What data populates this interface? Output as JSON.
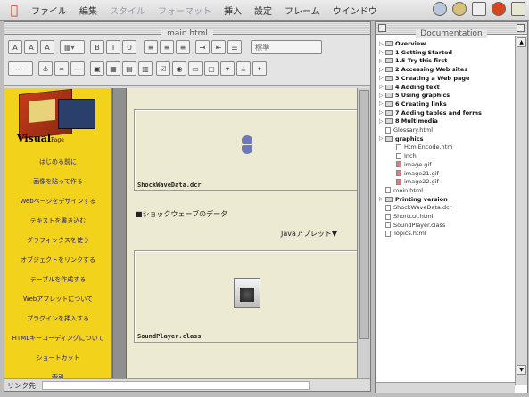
{
  "menubar": {
    "items": [
      "ファイル",
      "編集",
      "スタイル",
      "フォーマット",
      "挿入",
      "設定",
      "フレーム",
      "ウインドウ"
    ],
    "dim": [
      false,
      false,
      true,
      true,
      false,
      false,
      false,
      false
    ]
  },
  "editor": {
    "title": "main.html",
    "toolbar": {
      "buttons_row1": [
        "A",
        "A",
        "A",
        "B",
        "I",
        "U"
      ],
      "style_select": "標準",
      "font_select": "----"
    },
    "nav_links": [
      "はじめる前に",
      "画像を貼って作る",
      "Webページをデザインする",
      "テキストを書き込む",
      "グラフィックスを使う",
      "オブジェクトをリンクする",
      "テーブルを作成する",
      "Webアプレットについて",
      "プラグインを挿入する",
      "HTMLキーコーディングについて",
      "ショートカット",
      "索引"
    ],
    "logo_text": "Visual",
    "logo_sub": "Page",
    "objects": [
      {
        "caption": "ShockWaveData.dcr"
      },
      {
        "caption": "SoundPlayer.class"
      }
    ],
    "shockwave_text": "■ショックウェーブのデータ",
    "java_applet_text": "Javaアプレット▼",
    "status_label": "リンク先:"
  },
  "docwin": {
    "title": "Documentation",
    "items": [
      {
        "label": "Overview",
        "bold": true,
        "kind": "folder",
        "indent": 0
      },
      {
        "label": "1 Getting Started",
        "bold": true,
        "kind": "folder",
        "indent": 0
      },
      {
        "label": "1.5 Try this first",
        "bold": true,
        "kind": "folder",
        "indent": 0
      },
      {
        "label": "2 Accessing Web sites",
        "bold": true,
        "kind": "folder",
        "indent": 0
      },
      {
        "label": "3 Creating a Web page",
        "bold": true,
        "kind": "folder",
        "indent": 0
      },
      {
        "label": "4 Adding text",
        "bold": true,
        "kind": "folder",
        "indent": 0
      },
      {
        "label": "5 Using graphics",
        "bold": true,
        "kind": "folder",
        "indent": 0
      },
      {
        "label": "6 Creating links",
        "bold": true,
        "kind": "folder",
        "indent": 0
      },
      {
        "label": "7 Adding tables and forms",
        "bold": true,
        "kind": "folder",
        "indent": 0
      },
      {
        "label": "8 Multimedia",
        "bold": true,
        "kind": "folder",
        "indent": 0
      },
      {
        "label": "Glossary.html",
        "bold": false,
        "kind": "file",
        "indent": 0
      },
      {
        "label": "graphics",
        "bold": true,
        "kind": "folder",
        "indent": 0
      },
      {
        "label": "HtmlEncode.htm",
        "bold": false,
        "kind": "file",
        "indent": 1
      },
      {
        "label": "Inch",
        "bold": false,
        "kind": "file",
        "indent": 1
      },
      {
        "label": "image.gif",
        "bold": false,
        "kind": "gif",
        "indent": 1
      },
      {
        "label": "image21.gif",
        "bold": false,
        "kind": "gif",
        "indent": 1
      },
      {
        "label": "image22.gif",
        "bold": false,
        "kind": "gif",
        "indent": 1
      },
      {
        "label": "main.html",
        "bold": false,
        "kind": "file",
        "indent": 0
      },
      {
        "label": "Printing version",
        "bold": true,
        "kind": "folder",
        "indent": 0
      },
      {
        "label": "ShockWaveData.dcr",
        "bold": false,
        "kind": "file",
        "indent": 0
      },
      {
        "label": "Shortcut.html",
        "bold": false,
        "kind": "file",
        "indent": 0
      },
      {
        "label": "SoundPlayer.class",
        "bold": false,
        "kind": "file",
        "indent": 0
      },
      {
        "label": "Topics.html",
        "bold": false,
        "kind": "file",
        "indent": 0
      }
    ]
  }
}
